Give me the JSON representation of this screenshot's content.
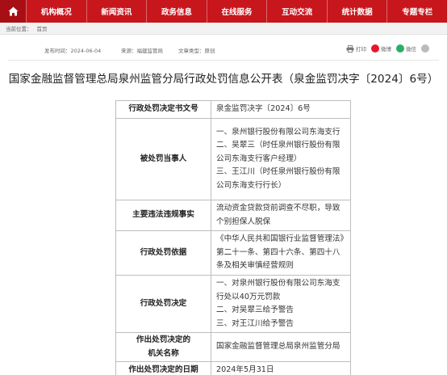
{
  "nav": {
    "home_icon": "home-icon",
    "items": [
      "机构概况",
      "新闻资讯",
      "政务信息",
      "在线服务",
      "互动交流",
      "统计数据",
      "专题专栏"
    ]
  },
  "breadcrumb": {
    "label": "当前位置：",
    "current": "首页"
  },
  "meta": {
    "published_label": "发布时间：",
    "published_value": "2024-06-04",
    "source_label": "来源：",
    "source_value": "福建监管局",
    "type_label": "文章类型：",
    "type_value": "原创"
  },
  "tools": {
    "print_label": "打印",
    "weibo_label": "微博",
    "wechat_label": "微信",
    "colors": {
      "weibo": "#e6162d",
      "wechat": "#2aae67",
      "more": "#999999"
    }
  },
  "title": "国家金融监督管理总局泉州监管分局行政处罚信息公开表（泉金监罚决字〔2024〕6号）",
  "table": {
    "rows": [
      {
        "key": "行政处罚决定书文号",
        "lines": [
          "泉金监罚决字〔2024〕6号"
        ]
      },
      {
        "key": "被处罚当事人",
        "lines": [
          "一、泉州银行股份有限公司东海支行",
          "二、吴翠三（时任泉州银行股份有限公司东海支行客户经理）",
          "三、王江川（时任泉州银行股份有限公司东海支行行长）"
        ]
      },
      {
        "key": "主要违法违规事实",
        "lines": [
          "流动资金贷款贷前调查不尽职，导致个别担保人脱保"
        ]
      },
      {
        "key": "行政处罚依据",
        "lines": [
          "《中华人民共和国银行业监督管理法》第二十一条、第四十六条、第四十八条及相关审慎经营规则"
        ]
      },
      {
        "key": "行政处罚决定",
        "lines": [
          "一、对泉州银行股份有限公司东海支行处以40万元罚款",
          "二、对吴翠三给予警告",
          "三、对王江川给予警告"
        ]
      },
      {
        "key_lines": [
          "作出处罚决定的",
          "机关名称"
        ],
        "lines": [
          "国家金融监督管理总局泉州监管分局"
        ]
      },
      {
        "key": "作出处罚决定的日期",
        "lines": [
          "2024年5月31日"
        ]
      }
    ]
  }
}
